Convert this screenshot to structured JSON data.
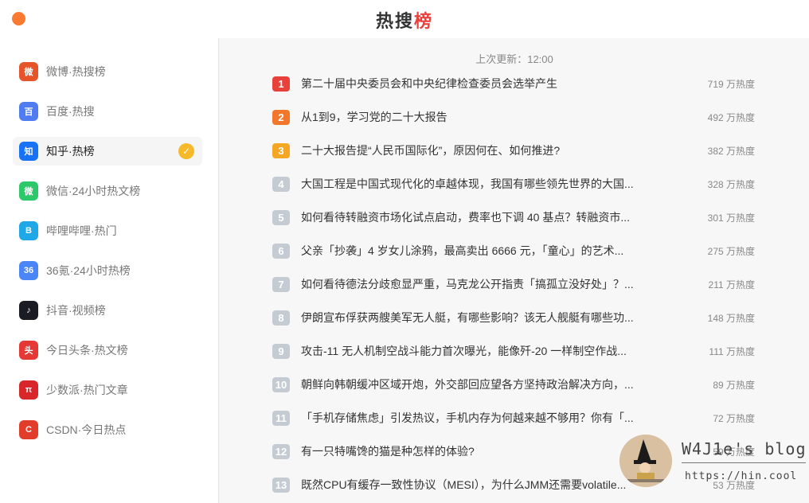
{
  "app": {
    "title_main": "热搜",
    "title_accent": "榜"
  },
  "sidebar": {
    "items": [
      {
        "label": "微博·热搜榜",
        "icon": "weibo-icon",
        "color": "#e6542a",
        "glyph": "微"
      },
      {
        "label": "百度·热搜",
        "icon": "baidu-icon",
        "color": "#4f7cf0",
        "glyph": "百"
      },
      {
        "label": "知乎·热榜",
        "icon": "zhihu-icon",
        "color": "#1772f6",
        "glyph": "知"
      },
      {
        "label": "微信·24小时热文榜",
        "icon": "wechat-icon",
        "color": "#2dc86a",
        "glyph": "微"
      },
      {
        "label": "哔哩哔哩·热门",
        "icon": "bilibili-icon",
        "color": "#1fa8e8",
        "glyph": "B"
      },
      {
        "label": "36氪·24小时热榜",
        "icon": "36kr-icon",
        "color": "#4a86f5",
        "glyph": "36"
      },
      {
        "label": "抖音·视频榜",
        "icon": "douyin-icon",
        "color": "#1b1b23",
        "glyph": "♪"
      },
      {
        "label": "今日头条·热文榜",
        "icon": "toutiao-icon",
        "color": "#e53935",
        "glyph": "头"
      },
      {
        "label": "少数派·热门文章",
        "icon": "sspai-icon",
        "color": "#d8262a",
        "glyph": "π"
      },
      {
        "label": "CSDN·今日热点",
        "icon": "csdn-icon",
        "color": "#e23d2a",
        "glyph": "C"
      }
    ],
    "active_index": 2
  },
  "main": {
    "update_text": "上次更新：12:00",
    "rank_colors": [
      "#e8413b",
      "#f3772b",
      "#f5a623"
    ],
    "rank_default_color": "#c5cbd3",
    "list": [
      {
        "rank": "1",
        "title": "第二十届中央委员会和中央纪律检查委员会选举产生",
        "heat": "719 万热度"
      },
      {
        "rank": "2",
        "title": "从1到9，学习党的二十大报告",
        "heat": "492 万热度"
      },
      {
        "rank": "3",
        "title": "二十大报告提“人民币国际化”，原因何在、如何推进?",
        "heat": "382 万热度"
      },
      {
        "rank": "4",
        "title": "大国工程是中国式现代化的卓越体现，我国有哪些领先世界的大国...",
        "heat": "328 万热度"
      },
      {
        "rank": "5",
        "title": "如何看待转融资市场化试点启动，费率也下调 40 基点？转融资市...",
        "heat": "301 万热度"
      },
      {
        "rank": "6",
        "title": "父亲「抄袭」4 岁女儿涂鸦，最高卖出 6666 元，「童心」的艺术...",
        "heat": "275 万热度"
      },
      {
        "rank": "7",
        "title": "如何看待德法分歧愈显严重，马克龙公开指责「搞孤立没好处」？...",
        "heat": "211 万热度"
      },
      {
        "rank": "8",
        "title": "伊朗宣布俘获两艘美军无人艇，有哪些影响？该无人舰艇有哪些功...",
        "heat": "148 万热度"
      },
      {
        "rank": "9",
        "title": "攻击-11 无人机制空战斗能力首次曝光，能像歼-20 一样制空作战...",
        "heat": "111 万热度"
      },
      {
        "rank": "10",
        "title": "朝鲜向韩朝缓冲区域开炮，外交部回应望各方坚持政治解决方向，...",
        "heat": "89 万热度"
      },
      {
        "rank": "11",
        "title": "「手机存储焦虑」引发热议，手机内存为何越来越不够用？你有「...",
        "heat": "72 万热度"
      },
      {
        "rank": "12",
        "title": "有一只特嘴馋的猫是种怎样的体验?",
        "heat": "59 万热度"
      },
      {
        "rank": "13",
        "title": "既然CPU有缓存一致性协议（MESI），为什么JMM还需要volatile...",
        "heat": "53 万热度"
      }
    ]
  },
  "watermark": {
    "title": "W4J1e's blog",
    "url": "https://hin.cool"
  }
}
